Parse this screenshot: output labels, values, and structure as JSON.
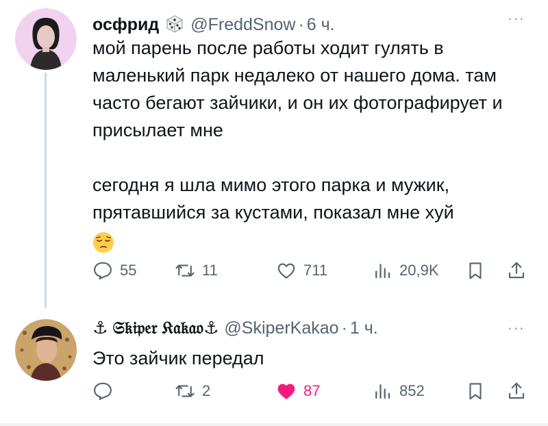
{
  "tweets": [
    {
      "display_name": "осфрид",
      "handle": "@FreddSnow",
      "separator": "·",
      "time": "6 ч.",
      "more_label": "···",
      "badge_icon": "die-icon",
      "paragraphs": [
        "мой парень после работы ходит гулять в маленький парк недалеко от нашего дома. там часто бегают зайчики, и он их фотографирует и присылает мне",
        "сегодня я шла мимо этого парка и мужик, прятавшийся за кустами, показал мне хуй"
      ],
      "emoji": "pensive-face-emoji",
      "actions": {
        "reply_count": "55",
        "retweet_count": "11",
        "like_count": "711",
        "views_count": "20,9K"
      },
      "liked": false
    },
    {
      "display_name": "⚓ 𝔖𝔨𝔦𝔭𝔢𝔯 𝔎𝔞𝔨𝔞𝔬⚓",
      "handle": "@SkiperKakao",
      "separator": "·",
      "time": "1 ч.",
      "more_label": "···",
      "text": "Это зайчик передал",
      "actions": {
        "reply_count": "",
        "retweet_count": "2",
        "like_count": "87",
        "views_count": "852"
      },
      "liked": true
    }
  ],
  "colors": {
    "text_primary": "#0f1419",
    "text_secondary": "#536471",
    "like_active": "#f91880",
    "thread_line": "#cfd9de"
  }
}
